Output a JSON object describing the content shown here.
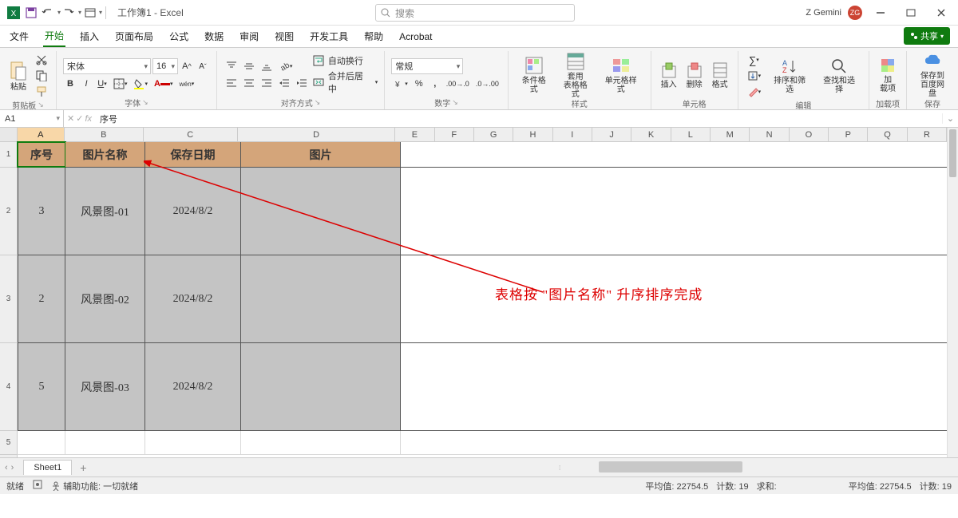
{
  "title": "工作簿1 - Excel",
  "search_placeholder": "搜索",
  "user": {
    "name": "Z Gemini",
    "initials": "ZG"
  },
  "tabs": {
    "file": "文件",
    "home": "开始",
    "insert": "插入",
    "layout": "页面布局",
    "formula": "公式",
    "data": "数据",
    "review": "审阅",
    "view": "视图",
    "dev": "开发工具",
    "help": "帮助",
    "acrobat": "Acrobat"
  },
  "share_label": "共享",
  "ribbon": {
    "clipboard": {
      "paste": "粘贴",
      "label": "剪贴板"
    },
    "font": {
      "family": "宋体",
      "size": "16",
      "label": "字体"
    },
    "align": {
      "wrap": "自动换行",
      "merge": "合并后居中",
      "label": "对齐方式"
    },
    "number": {
      "format": "常规",
      "label": "数字"
    },
    "styles": {
      "cond": "条件格式",
      "table": "套用\n表格格式",
      "cell": "单元格样式",
      "label": "样式"
    },
    "cells": {
      "insert": "插入",
      "delete": "删除",
      "format": "格式",
      "label": "单元格"
    },
    "editing": {
      "sort": "排序和筛选",
      "find": "查找和选择",
      "label": "编辑"
    },
    "addins": {
      "addin": "加\n载项",
      "label": "加载项"
    },
    "save": {
      "baidu": "保存到\n百度网盘",
      "label": "保存"
    }
  },
  "namebox": "A1",
  "formula": "序号",
  "columns": [
    "A",
    "B",
    "C",
    "D",
    "E",
    "F",
    "G",
    "H",
    "I",
    "J",
    "K",
    "L",
    "M",
    "N",
    "O",
    "P",
    "Q",
    "R"
  ],
  "col_widths": {
    "A": 60,
    "B": 100,
    "C": 120,
    "D": 200,
    "rest": 50
  },
  "row_heights": {
    "1": 32,
    "2": 110,
    "3": 110,
    "4": 110,
    "5": 30
  },
  "table": {
    "headers": {
      "A": "序号",
      "B": "图片名称",
      "C": "保存日期",
      "D": "图片"
    },
    "rows": [
      {
        "A": "3",
        "B": "风景图-01",
        "C": "2024/8/2",
        "D": ""
      },
      {
        "A": "2",
        "B": "风景图-02",
        "C": "2024/8/2",
        "D": ""
      },
      {
        "A": "5",
        "B": "风景图-03",
        "C": "2024/8/2",
        "D": ""
      }
    ]
  },
  "annotation": "表格按 \"图片名称\" 升序排序完成",
  "sheet_tab": "Sheet1",
  "status": {
    "ready": "就绪",
    "access": "辅助功能: 一切就绪",
    "avg_label": "平均值:",
    "avg": "22754.5",
    "count_label": "计数:",
    "count": "19",
    "sum_label": "求和:",
    "avg2_label": "平均值:",
    "avg2": "22754.5",
    "count2_label": "计数:",
    "count2": "19"
  },
  "chart_data": {
    "type": "table",
    "title": "",
    "columns": [
      "序号",
      "图片名称",
      "保存日期",
      "图片"
    ],
    "rows": [
      [
        3,
        "风景图-01",
        "2024/8/2",
        ""
      ],
      [
        2,
        "风景图-02",
        "2024/8/2",
        ""
      ],
      [
        5,
        "风景图-03",
        "2024/8/2",
        ""
      ]
    ]
  }
}
